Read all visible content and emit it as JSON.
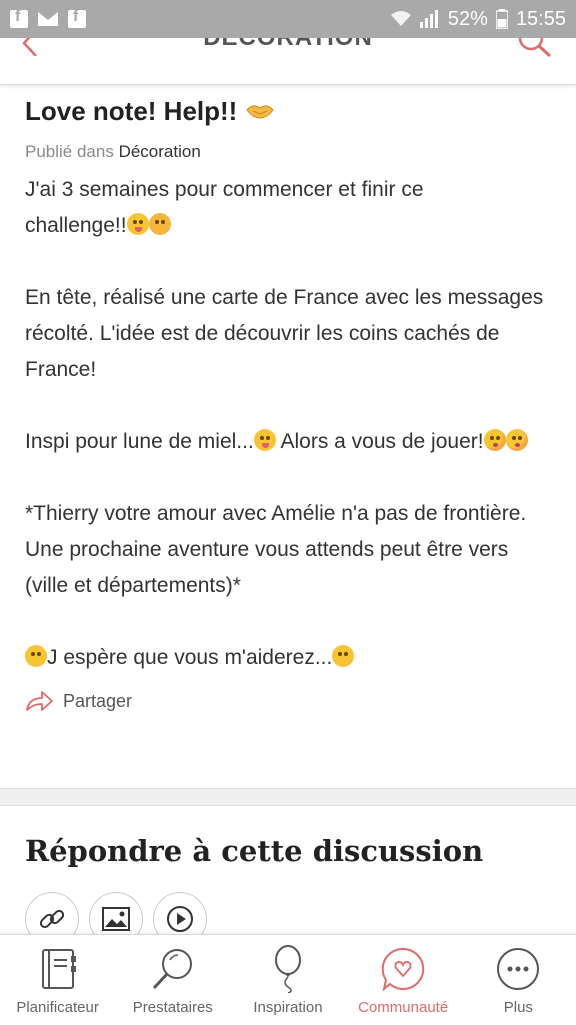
{
  "status_bar": {
    "battery": "52%",
    "time": "15:55",
    "icons": [
      "facebook-icon",
      "mail-icon",
      "facebook-icon",
      "wifi-icon",
      "signal-icon",
      "battery-icon"
    ]
  },
  "app_header": {
    "title": "DÉCORATION",
    "accent_color": "#e06a6a"
  },
  "post": {
    "title": "Love note! Help!!",
    "meta_prefix": "Publié dans",
    "meta_category": "Décoration",
    "paragraphs": {
      "p1_a": "J'ai 3 semaines pour commencer et finir ce",
      "p1_b": "challenge!!",
      "p2": "En tête, réalisé une carte de France avec les messages récolté. L'idée est de découvrir les coins cachés de France!",
      "p3_a": "Inspi pour lune de miel...",
      "p3_b": " Alors a vous de jouer!",
      "p4": "*Thierry votre amour avec Amélie n'a pas de frontière. Une prochaine aventure vous attends peut être vers (ville et départements)*",
      "p5_a": "J espère que vous m'aiderez..."
    },
    "share_label": "Partager"
  },
  "reply": {
    "title": "Répondre à cette discussion"
  },
  "bottom_nav": {
    "items": [
      {
        "label": "Planificateur",
        "icon": "notebook-icon",
        "active": false
      },
      {
        "label": "Prestataires",
        "icon": "magnifier-icon",
        "active": false
      },
      {
        "label": "Inspiration",
        "icon": "balloon-icon",
        "active": false
      },
      {
        "label": "Communauté",
        "icon": "chat-heart-icon",
        "active": true
      },
      {
        "label": "Plus",
        "icon": "more-icon",
        "active": false
      }
    ]
  }
}
